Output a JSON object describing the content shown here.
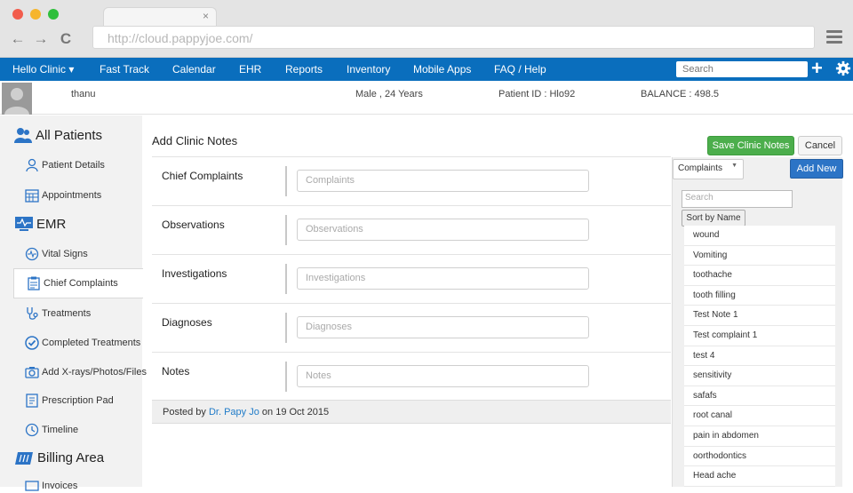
{
  "browser": {
    "url": "http://cloud.pappyjoe.com/",
    "tab_close": "×",
    "back": "←",
    "forward": "→",
    "reload": "C",
    "colors": {
      "close": "#f25c4c",
      "minimize": "#f6b52b",
      "maximize": "#2fbf3c"
    }
  },
  "nav": {
    "items": [
      "Hello Clinic ▾",
      "Fast Track",
      "Calendar",
      "EHR",
      "Reports",
      "Inventory",
      "Mobile Apps",
      "FAQ / Help"
    ],
    "search_placeholder": "Search",
    "plus": "+",
    "accent": "#0a6ebd"
  },
  "patient": {
    "name": "thanu",
    "gender_age": "Male , 24 Years",
    "patient_id": "Patient ID : Hlo92",
    "balance": "BALANCE :  498.5"
  },
  "sidebar": {
    "sections": [
      {
        "label": "All Patients",
        "icon": "users-icon"
      },
      {
        "label": "EMR",
        "icon": "monitor-icon"
      },
      {
        "label": "Billing Area",
        "icon": "billing-icon"
      }
    ],
    "items": [
      {
        "label": "Patient Details",
        "icon": "user-icon"
      },
      {
        "label": "Appointments",
        "icon": "calendar-icon"
      },
      {
        "label": "Vital Signs",
        "icon": "vitals-icon"
      },
      {
        "label": "Chief Complaints",
        "icon": "clipboard-icon",
        "active": true
      },
      {
        "label": "Treatments",
        "icon": "stethoscope-icon"
      },
      {
        "label": "Completed Treatments",
        "icon": "check-circle-icon"
      },
      {
        "label": "Add X-rays/Photos/Files",
        "icon": "camera-icon"
      },
      {
        "label": "Prescription Pad",
        "icon": "prescription-icon"
      },
      {
        "label": "Timeline",
        "icon": "timeline-icon"
      },
      {
        "label": "Invoices",
        "icon": "invoice-icon"
      }
    ]
  },
  "main": {
    "title": "Add Clinic Notes",
    "save_label": "Save Clinic Notes",
    "cancel_label": "Cancel",
    "fields": [
      {
        "label": "Chief Complaints",
        "placeholder": "Complaints"
      },
      {
        "label": "Observations",
        "placeholder": "Observations"
      },
      {
        "label": "Investigations",
        "placeholder": "Investigations"
      },
      {
        "label": "Diagnoses",
        "placeholder": "Diagnoses"
      },
      {
        "label": "Notes",
        "placeholder": "Notes"
      }
    ],
    "posted_prefix": "Posted by",
    "posted_author": "Dr. Papy Jo",
    "posted_suffix": "on 19 Oct 2015"
  },
  "panel": {
    "select_value": "Complaints",
    "add_new_label": "Add New",
    "search_placeholder": "Search",
    "sort_label": "Sort by Name",
    "items": [
      "wound",
      "Vomiting",
      "toothache",
      "tooth filling",
      "Test Note 1",
      "Test complaint 1",
      "test 4",
      "sensitivity",
      "safafs",
      "root canal",
      "pain in abdomen",
      "oorthodontics",
      "Head ache"
    ]
  }
}
